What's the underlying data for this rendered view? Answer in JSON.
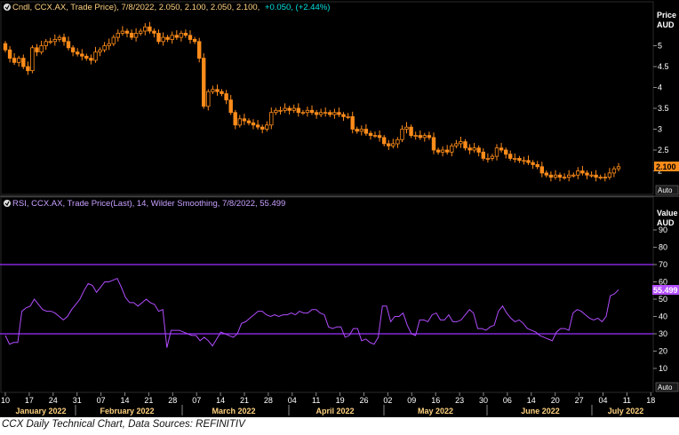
{
  "colors": {
    "background": "#000000",
    "candle": "#ff8c1a",
    "rsi_line": "#b24dff",
    "rsi_level": "#9b30ff",
    "price_badge": "#ff8c1a",
    "rsi_badge": "#b24dff",
    "legend_price_text": "#ffd27f",
    "change_text": "#00e0e0",
    "legend_rsi_text": "#c8a0ff",
    "axis_text": "#ffffff",
    "month_label": "#ffd27f"
  },
  "price_panel": {
    "legend": "Cndl, CCX.AX, Trade Price), 7/8/2022, 2.050, 2.100, 2.050, 2.100,",
    "change": "+0.050, (+2.44%)",
    "axis_title": "Price",
    "axis_unit": "AUD",
    "last_value_label": "2.100",
    "auto_label": "Auto",
    "y_ticks": [
      "5",
      "4.5",
      "4",
      "3.5",
      "3",
      "2.5",
      "2"
    ]
  },
  "rsi_panel": {
    "legend": "RSI, CCX.AX, Trade Price(Last), 14, Wilder Smoothing, 7/8/2022, 55.499",
    "axis_title": "Value",
    "axis_unit": "AUD",
    "last_value_label": "55.499",
    "auto_label": "Auto",
    "y_ticks": [
      "90",
      "80",
      "70",
      "60",
      "50",
      "40",
      "30",
      "20",
      "10"
    ]
  },
  "x_axis": {
    "day_ticks": [
      "10",
      "17",
      "24",
      "31",
      "07",
      "14",
      "21",
      "28",
      "07",
      "14",
      "21",
      "28",
      "04",
      "11",
      "19",
      "26",
      "02",
      "09",
      "16",
      "23",
      "30",
      "06",
      "14",
      "20",
      "27",
      "04",
      "11",
      "18"
    ],
    "months": [
      "January 2022",
      "February 2022",
      "March 2022",
      "April 2022",
      "May 2022",
      "June 2022",
      "July 2022"
    ]
  },
  "caption": "CCX Daily Technical Chart, Data Sources: REFINITIV",
  "chart_data": [
    {
      "type": "candlestick",
      "series": [
        {
          "name": "CCX.AX, Trade Price",
          "x_units": "trading-day index from 10 Jan 2022",
          "close": [
            4.9,
            4.7,
            4.6,
            4.7,
            4.5,
            4.4,
            4.95,
            4.85,
            5.0,
            5.1,
            5.1,
            5.15,
            5.2,
            5.1,
            4.95,
            4.85,
            4.8,
            4.75,
            4.7,
            4.65,
            4.85,
            4.9,
            5.0,
            5.05,
            5.2,
            5.3,
            5.35,
            5.3,
            5.2,
            5.3,
            5.35,
            5.45,
            5.35,
            5.3,
            5.1,
            5.2,
            5.15,
            5.25,
            5.2,
            5.3,
            5.25,
            5.15,
            5.1,
            4.7,
            3.55,
            3.9,
            3.95,
            3.9,
            3.85,
            3.7,
            3.4,
            3.1,
            3.25,
            3.2,
            3.15,
            3.1,
            3.05,
            3.0,
            3.1,
            3.4,
            3.45,
            3.45,
            3.5,
            3.45,
            3.5,
            3.4,
            3.4,
            3.45,
            3.4,
            3.35,
            3.4,
            3.4,
            3.35,
            3.4,
            3.35,
            3.3,
            3.3,
            3.0,
            2.95,
            3.0,
            2.9,
            2.85,
            2.85,
            2.8,
            2.65,
            2.6,
            2.65,
            2.75,
            3.0,
            3.05,
            2.85,
            2.85,
            2.8,
            2.85,
            2.8,
            2.5,
            2.45,
            2.5,
            2.45,
            2.6,
            2.65,
            2.7,
            2.55,
            2.5,
            2.55,
            2.45,
            2.3,
            2.3,
            2.35,
            2.55,
            2.5,
            2.4,
            2.3,
            2.3,
            2.25,
            2.25,
            2.2,
            2.15,
            2.1,
            1.95,
            1.9,
            1.85,
            1.9,
            1.85,
            1.85,
            1.9,
            1.9,
            2.0,
            1.95,
            1.9,
            1.9,
            1.85,
            1.85,
            1.85,
            1.95,
            2.05,
            2.1
          ]
        }
      ],
      "ylim": [
        1.75,
        5.7
      ]
    },
    {
      "type": "line",
      "series": [
        {
          "name": "RSI, CCX.AX, Trade Price(Last), 14, Wilder Smoothing",
          "values": [
            29,
            24,
            25,
            25,
            43,
            45,
            46,
            50,
            47,
            44,
            43,
            43,
            42,
            40,
            38,
            40,
            44,
            47,
            50,
            55,
            59,
            58,
            54,
            57,
            60,
            60,
            61,
            62,
            57,
            51,
            48,
            48,
            46,
            48,
            50,
            48,
            47,
            43,
            44,
            22,
            32,
            32,
            32,
            31,
            30,
            29,
            29,
            26,
            28,
            26,
            23,
            27,
            31,
            30,
            29,
            28,
            30,
            36,
            37,
            39,
            41,
            43,
            43,
            41,
            40,
            41,
            40,
            41,
            41,
            42,
            41,
            43,
            42,
            42,
            44,
            44,
            42,
            41,
            34,
            33,
            34,
            34,
            28,
            29,
            33,
            33,
            26,
            27,
            25,
            24,
            28,
            46,
            46,
            37,
            40,
            40,
            42,
            35,
            30,
            29,
            38,
            38,
            37,
            41,
            42,
            38,
            38,
            41,
            37,
            37,
            38,
            41,
            44,
            42,
            33,
            33,
            32,
            34,
            35,
            43,
            46,
            42,
            39,
            37,
            38,
            36,
            33,
            32,
            31,
            29,
            28,
            27,
            26,
            31,
            33,
            33,
            32,
            42,
            44,
            43,
            41,
            39,
            38,
            39,
            37,
            40,
            52,
            53,
            55.5
          ]
        }
      ],
      "levels": [
        70,
        30
      ],
      "ylim": [
        0,
        100
      ]
    }
  ]
}
